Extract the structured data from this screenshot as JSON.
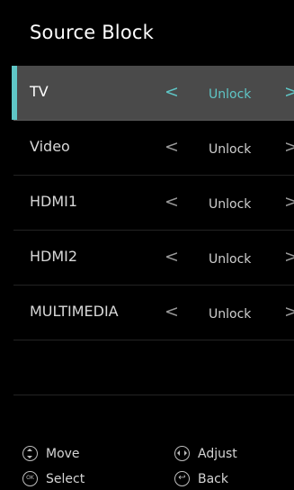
{
  "title": "Source Block",
  "rows": [
    {
      "label": "TV",
      "value": "Unlock",
      "selected": true
    },
    {
      "label": "Video",
      "value": "Unlock",
      "selected": false
    },
    {
      "label": "HDMI1",
      "value": "Unlock",
      "selected": false
    },
    {
      "label": "HDMI2",
      "value": "Unlock",
      "selected": false
    },
    {
      "label": "MULTIMEDIA",
      "value": "Unlock",
      "selected": false
    }
  ],
  "arrows": {
    "left": "<",
    "right": ">"
  },
  "footer": {
    "move_label": "Move",
    "adjust_label": "Adjust",
    "select_label": "Select",
    "back_label": "Back",
    "ok_icon_text": "OK",
    "back_icon_glyph": "↩"
  },
  "colors": {
    "accent": "#5fc6c6",
    "selected_row_bg": "#4a4a4a",
    "background": "#000000"
  },
  "icons": {
    "move": "up-down-icon",
    "adjust": "left-right-icon",
    "select": "ok-icon",
    "back": "back-icon"
  }
}
